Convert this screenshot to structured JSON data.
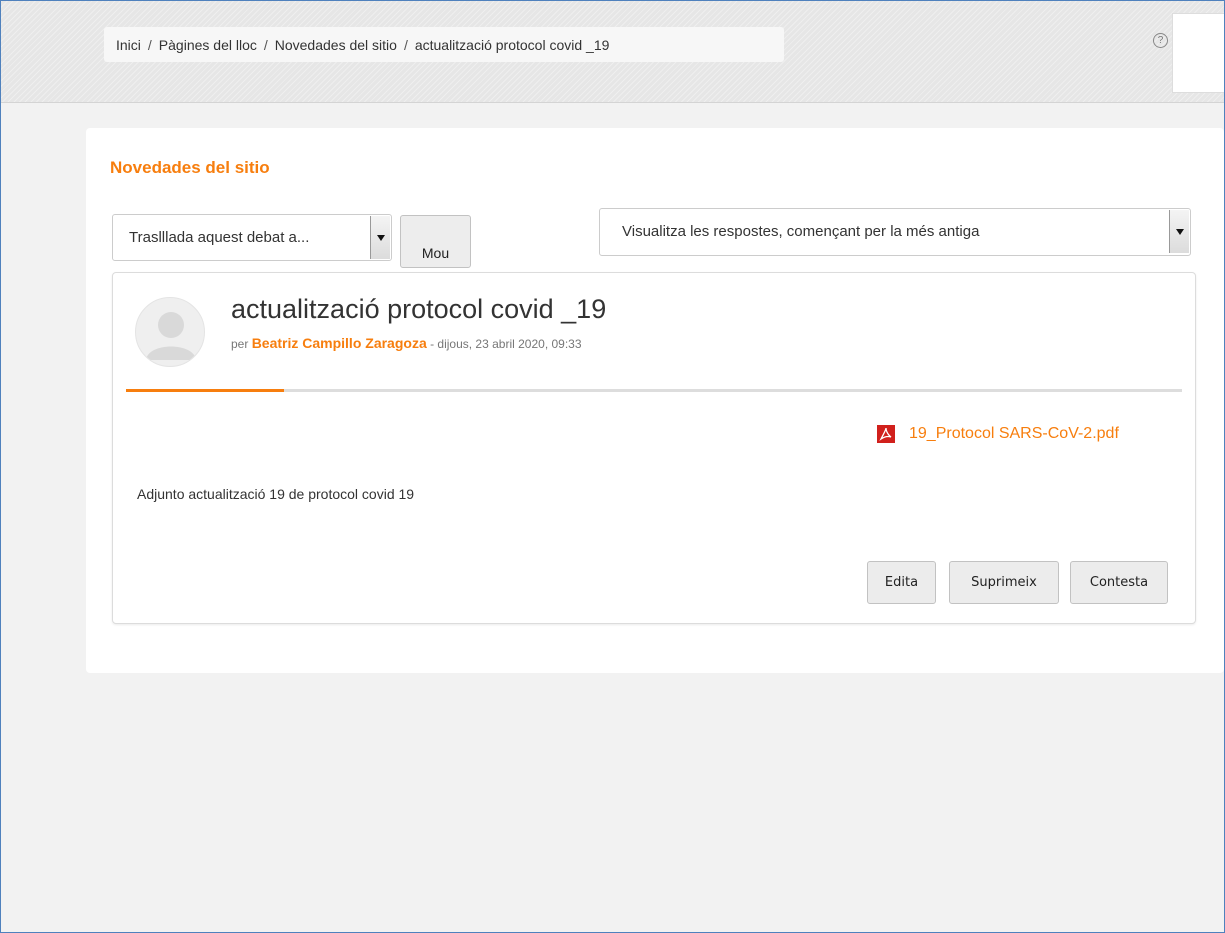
{
  "breadcrumb": [
    "Inici",
    "Pàgines del lloc",
    "Novedades del sitio",
    "actualització protocol covid _19"
  ],
  "help_icon": "?",
  "section_title": "Novedades del sitio",
  "move_select": {
    "value": "Traslllada aquest debat a..."
  },
  "move_button": "Mou",
  "order_select": {
    "value": "Visualitza les respostes, començant per la més antiga"
  },
  "post": {
    "subject": "actualització protocol covid _19",
    "by_prefix": "per",
    "author": "Beatriz Campillo Zaragoza",
    "date": "- dijous, 23 abril 2020, 09:33",
    "progress": 0.15,
    "attachment": "19_Protocol SARS-CoV-2.pdf",
    "message": "Adjunto actualització 19 de protocol  covid 19",
    "actions": [
      "Edita",
      "Suprimeix",
      "Contesta"
    ]
  },
  "colors": {
    "accent": "#f77e0e",
    "frame": "#4f81bd"
  }
}
